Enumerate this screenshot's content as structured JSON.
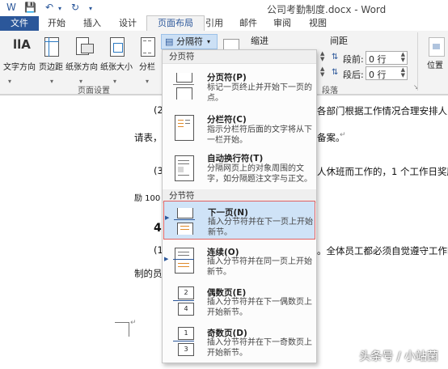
{
  "window": {
    "title": "公司考勤制度.docx - Word"
  },
  "tabs": [
    "文件",
    "开始",
    "插入",
    "设计",
    "页面布局",
    "引用",
    "邮件",
    "审阅",
    "视图"
  ],
  "ribbon": {
    "buttons": [
      "文字方向",
      "页边距",
      "纸张方向",
      "纸张大小",
      "分栏"
    ],
    "group_label": "页面设置",
    "breaks_button": "分隔符",
    "indent_label": "缩进",
    "spacing_label": "间距",
    "before_label": "段前:",
    "before_value": "0 行",
    "after_label": "段后:",
    "after_value": "0 行",
    "paragraph_label": "段落",
    "position_label": "位置"
  },
  "menu": {
    "page_breaks_header": "分页符",
    "section_breaks_header": "分节符",
    "items": [
      {
        "title": "分页符(P)",
        "desc": "标记一页终止并开始下一页的点。"
      },
      {
        "title": "分栏符(C)",
        "desc": "指示分栏符后面的文字将从下一栏开始。"
      },
      {
        "title": "自动换行符(T)",
        "desc": "分隔网页上的对象周围的文字，如分隔题注文字与正文。"
      },
      {
        "title": "下一页(N)",
        "desc": "插入分节符并在下一页上开始新节。"
      },
      {
        "title": "连续(O)",
        "desc": "插入分节符并在同一页上开始新节。"
      },
      {
        "title": "偶数页(E)",
        "desc": "插入分节符并在下一偶数页上开始新节。"
      },
      {
        "title": "奇数页(D)",
        "desc": "插入分节符并在下一奇数页上开始新节。"
      }
    ]
  },
  "document": {
    "line1_left": "(2)",
    "line1_right": "各部门根据工作情况合理安排人员",
    "line2_left": "请表，",
    "line2_right": "备案。",
    "line3_left": "(3)",
    "line3_right": "人休班而工作的，1 个工作日奖励",
    "line4_left": "励 100",
    "line5_left": "4",
    "line6_left": "(1)",
    "line6_right": "。全体员工都必须自觉遵守工作时",
    "line7_left": "制的员"
  },
  "watermark": "头条号 / 小站菌"
}
